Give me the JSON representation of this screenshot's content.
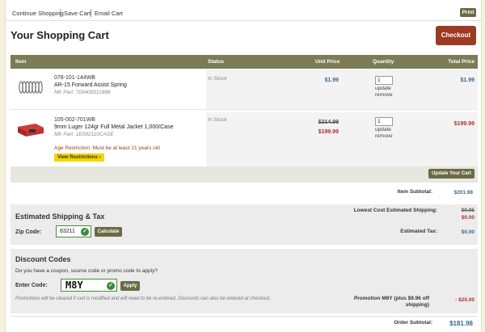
{
  "topnav": {
    "continue_shopping": "Continue Shopping",
    "save_cart": "Save Cart",
    "email_cart": "Email Cart",
    "print": "Print"
  },
  "page_title": "Your Shopping Cart",
  "checkout_label": "Checkout",
  "table_headers": {
    "item": "Item",
    "status": "Status",
    "unit_price": "Unit Price",
    "quantity": "Quantity",
    "total_price": "Total Price"
  },
  "items": [
    {
      "sku": "078-101-144WB",
      "name": "AR-15 Forward Assist Spring",
      "mfr_part": "Mfr Part: 709400011888",
      "status": "In Stock",
      "unit_price": "$1.99",
      "quantity": "1",
      "update": "update",
      "remove": "remove",
      "total": "$1.99"
    },
    {
      "sku": "105-002-701WB",
      "name": "9mm Luger 124gr Full Metal Jacket 1,000/Case",
      "mfr_part": "Mfr Part: 1E092110CASE",
      "status": "In Stock",
      "original_price": "$214.99",
      "unit_price": "$199.99",
      "quantity": "1",
      "update": "update",
      "remove": "remove",
      "total": "$199.99",
      "age_restriction": "Age Restriction: Must be at least 21 years old",
      "view_restrictions": "View Restrictions ›"
    }
  ],
  "update_cart_label": "Update Your Cart",
  "summary": {
    "item_subtotal_label": "Item Subtotal:",
    "item_subtotal": "$201.98",
    "shipping_label": "Lowest Cost Estimated Shipping:",
    "shipping_original": "$9.95",
    "shipping_value": "$0.00",
    "tax_label": "Estimated Tax:",
    "tax_value": "$0.00",
    "promo_label": "Promotion M8Y (plus $9.96 off shipping)",
    "promo_value": "- $20.00",
    "order_subtotal_label": "Order Subtotal:",
    "order_subtotal": "$181.98"
  },
  "shipping": {
    "heading": "Estimated Shipping & Tax",
    "zip_label": "Zip Code:",
    "zip_value": "83211",
    "calculate": "Calculate"
  },
  "discount": {
    "heading": "Discount Codes",
    "prompt": "Do you have a coupon, source code or promo code to apply?",
    "code_label": "Enter Code:",
    "code_value": "M8Y",
    "apply": "Apply",
    "note": "Promotions will be cleared if cart is modified and will need to be re-entered. Discounts can also be entered at checkout."
  },
  "colors": {
    "header_bar": "#7b7b55",
    "checkout_button": "#9c3a22",
    "price_blue": "#356c8a",
    "price_red": "#b03030",
    "valid_green": "#3c8a3c",
    "restriction_badge": "#f5d400"
  }
}
